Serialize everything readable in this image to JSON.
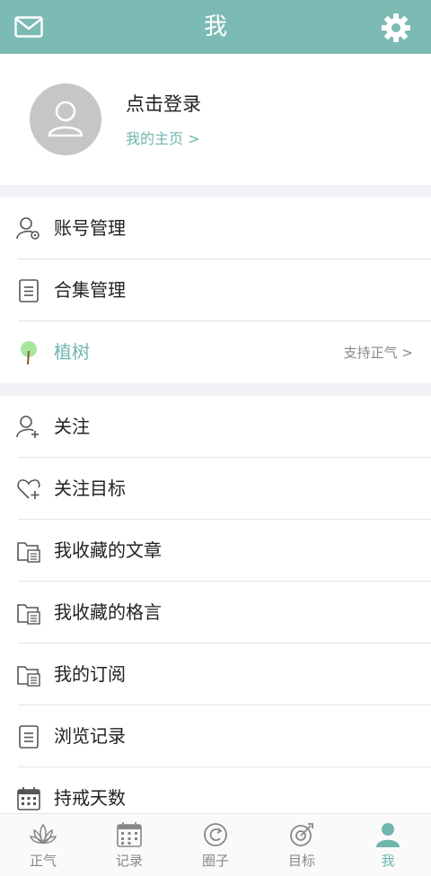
{
  "header": {
    "title": "我"
  },
  "profile": {
    "login_text": "点击登录",
    "homepage_link": "我的主页 >"
  },
  "group1": [
    {
      "label": "账号管理",
      "icon": "user-settings-icon"
    },
    {
      "label": "合集管理",
      "icon": "document-icon"
    },
    {
      "label": "植树",
      "icon": "tree-icon",
      "right": "支持正气 >"
    }
  ],
  "group2": [
    {
      "label": "关注",
      "icon": "user-add-icon"
    },
    {
      "label": "关注目标",
      "icon": "heart-add-icon"
    },
    {
      "label": "我收藏的文章",
      "icon": "folder-icon"
    },
    {
      "label": "我收藏的格言",
      "icon": "folder-icon"
    },
    {
      "label": "我的订阅",
      "icon": "folder-icon"
    },
    {
      "label": "浏览记录",
      "icon": "document-icon"
    },
    {
      "label": "持戒天数",
      "icon": "calendar-icon"
    }
  ],
  "tabs": [
    {
      "label": "正气",
      "icon": "lotus-icon"
    },
    {
      "label": "记录",
      "icon": "calendar-icon"
    },
    {
      "label": "圈子",
      "icon": "circle-icon"
    },
    {
      "label": "目标",
      "icon": "target-icon"
    },
    {
      "label": "我",
      "icon": "person-icon",
      "active": true
    }
  ],
  "colors": {
    "accent": "#7cbbb3",
    "accent_text": "#6fb6ac",
    "background": "#f2f2f6"
  }
}
